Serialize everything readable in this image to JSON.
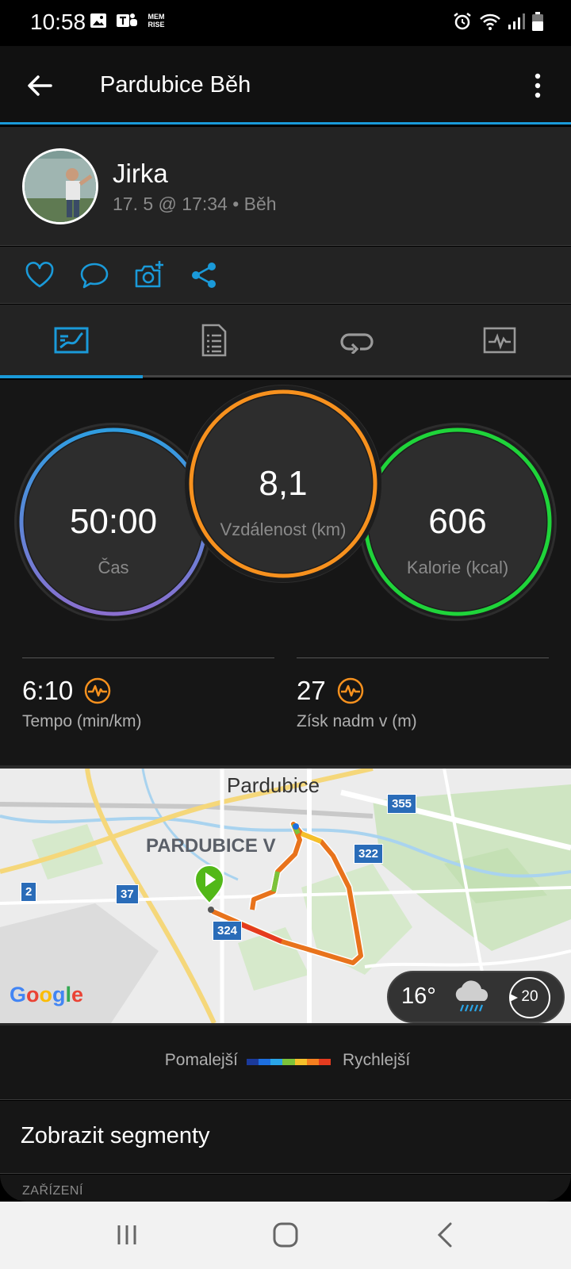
{
  "status_bar": {
    "time": "10:58",
    "left_icons": [
      "image-icon",
      "teams-icon",
      "memrise-icon"
    ],
    "right_icons": [
      "alarm-icon",
      "wifi-icon",
      "signal-icon",
      "battery-icon"
    ],
    "memrise_text": "MEM RISE"
  },
  "app_bar": {
    "title": "Pardubice Běh",
    "back_icon": "arrow-left-icon",
    "menu_icon": "more-vertical-icon"
  },
  "profile": {
    "name": "Jirka",
    "meta": "17. 5 @ 17:34 • Běh"
  },
  "actions": [
    "heart-icon",
    "comment-icon",
    "add-photo-icon",
    "share-icon"
  ],
  "tabs": [
    {
      "icon": "overview-icon",
      "selected": true
    },
    {
      "icon": "details-icon",
      "selected": false
    },
    {
      "icon": "laps-icon",
      "selected": false
    },
    {
      "icon": "chart-icon",
      "selected": false
    }
  ],
  "stats": {
    "time": {
      "value": "50:00",
      "label": "Čas"
    },
    "distance": {
      "value": "8,1",
      "label": "Vzdálenost (km)"
    },
    "calories": {
      "value": "606",
      "label": "Kalorie (kcal)"
    },
    "pace": {
      "value": "6:10",
      "label": "Tempo (min/km)"
    },
    "elevation": {
      "value": "27",
      "label": "Získ nadm v (m)"
    }
  },
  "colors": {
    "accent": "#1a9ad9",
    "time_ring": "#6f7fd6",
    "distance_ring": "#f7911e",
    "calories_ring": "#1fd43a",
    "pulse_icon": "#f7911e"
  },
  "map": {
    "city_label": "Pardubice",
    "district_label": "PARDUBICE V",
    "road_labels": [
      "355",
      "322",
      "2",
      "37",
      "324"
    ],
    "google_logo": "Google",
    "weather": {
      "temp": "16°",
      "icon": "rain-cloud-icon",
      "wind": "20"
    }
  },
  "legend": {
    "slower": "Pomalejší",
    "faster": "Rychlejší",
    "gradient": [
      "#1b3a9b",
      "#1d6fe0",
      "#2aa6e8",
      "#7cc33a",
      "#f5c02a",
      "#f57f1f",
      "#e53b1f"
    ]
  },
  "segments": {
    "label": "Zobrazit segmenty"
  },
  "device": {
    "label": "ZAŘÍZENÍ"
  },
  "nav_bar": [
    "recent-apps-icon",
    "home-icon",
    "back-icon"
  ]
}
